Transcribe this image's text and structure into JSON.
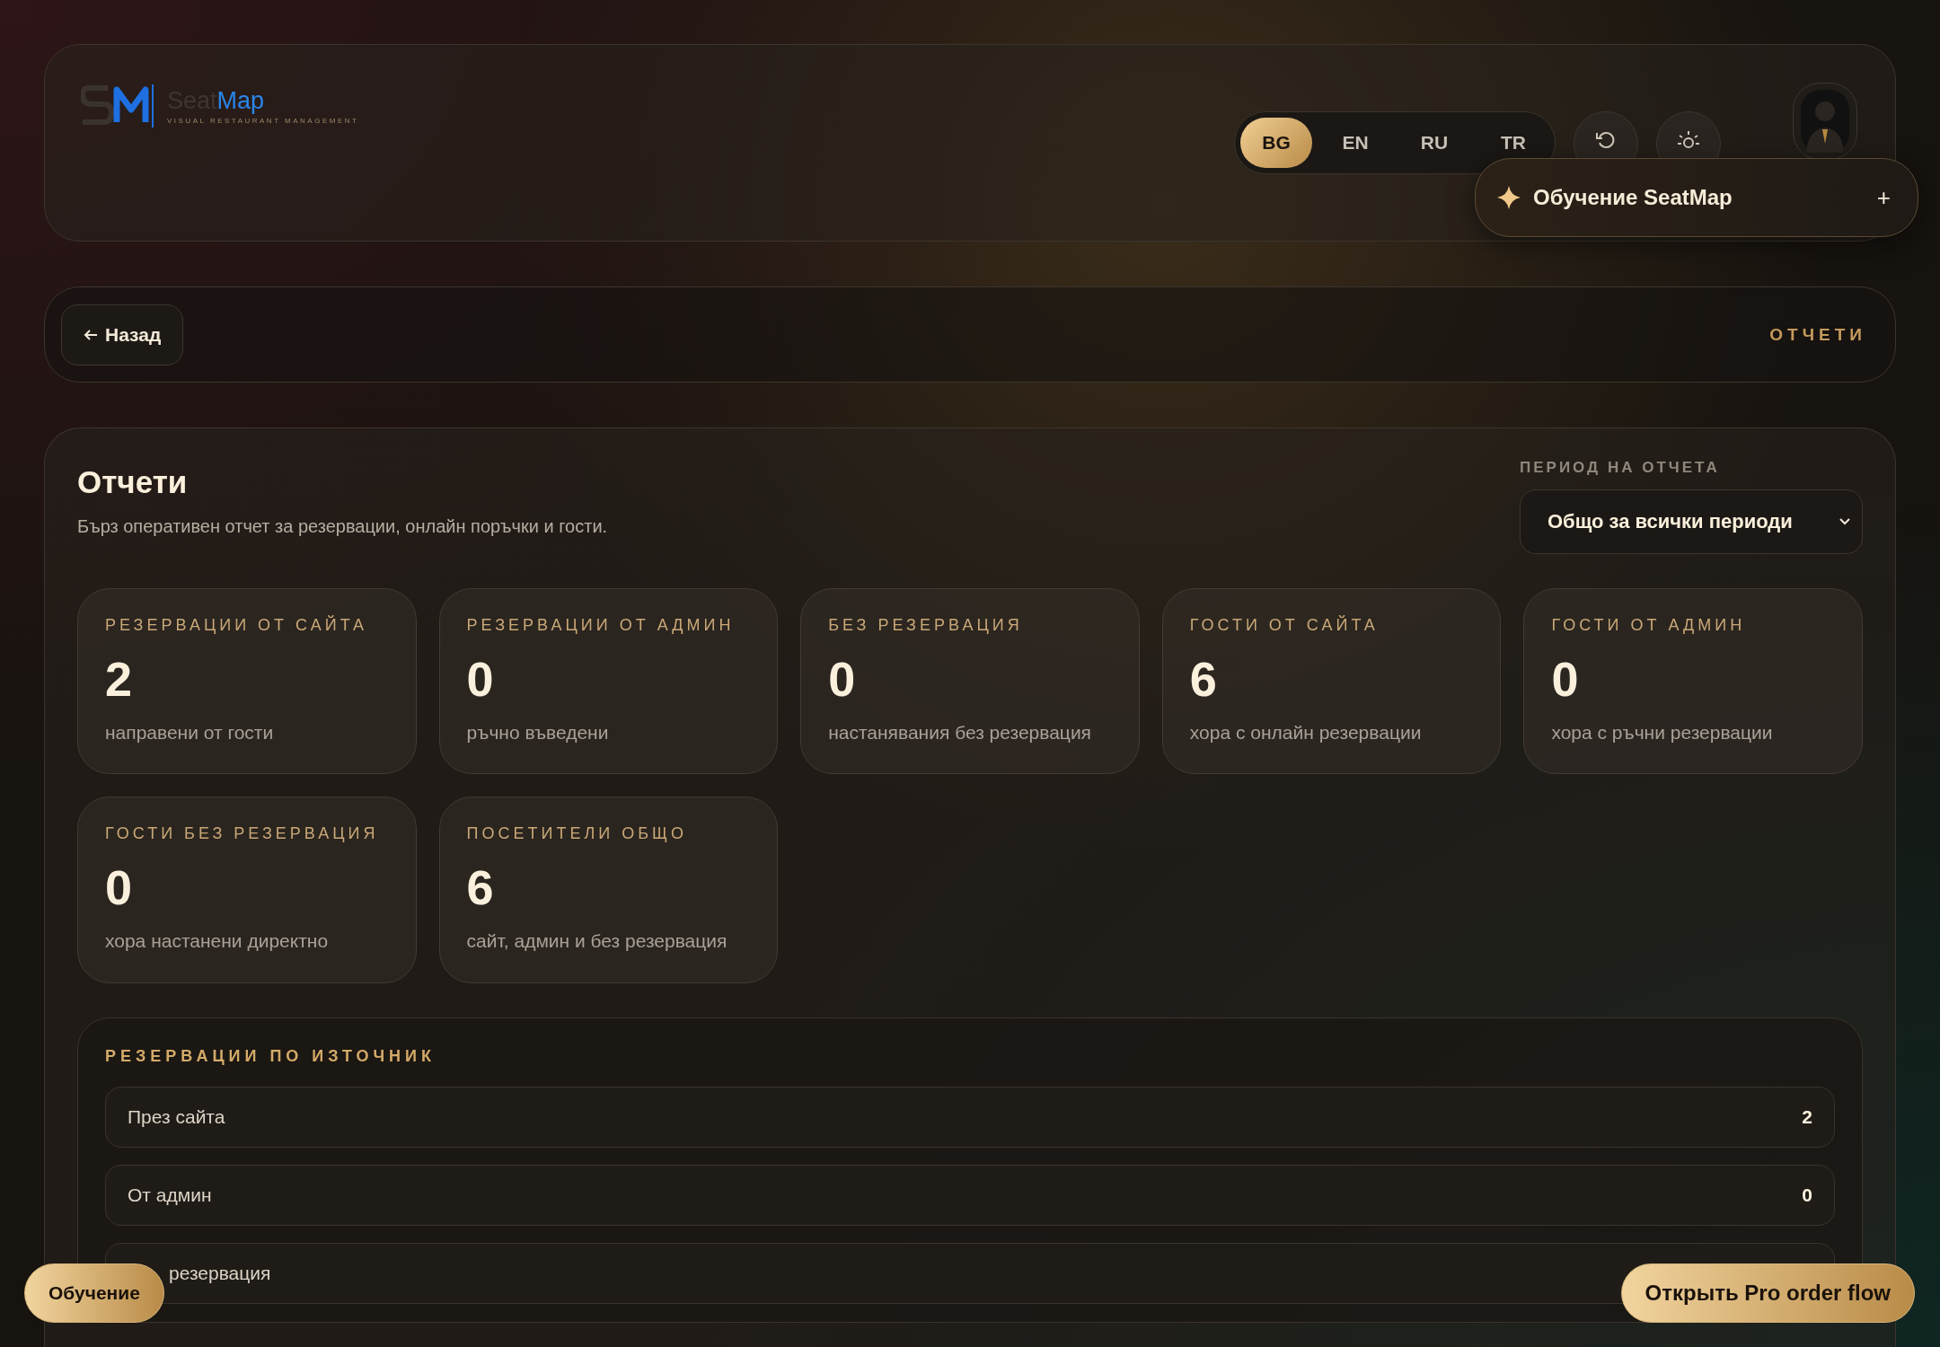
{
  "header": {
    "logo": {
      "word_1": "Seat",
      "word_2": "Map",
      "tagline": "VISUAL RESTAURANT MANAGEMENT"
    },
    "languages": [
      {
        "label": "BG",
        "selected": true
      },
      {
        "label": "EN",
        "selected": false
      },
      {
        "label": "RU",
        "selected": false
      },
      {
        "label": "TR",
        "selected": false
      }
    ],
    "tour_popup": {
      "title": "Обучение SeatMap",
      "toggle": "+"
    }
  },
  "nav": {
    "back": "Назад",
    "section": "ОТЧЕТИ"
  },
  "report": {
    "title": "Отчети",
    "subtitle": "Бърз оперативен отчет за резервации, онлайн поръчки и гости.",
    "period_label": "ПЕРИОД НА ОТЧЕТА",
    "period_value": "Общо за всички периоди",
    "stats": [
      {
        "label": "РЕЗЕРВАЦИИ ОТ САЙТА",
        "value": "2",
        "note": "направени от гости"
      },
      {
        "label": "РЕЗЕРВАЦИИ ОТ АДМИН",
        "value": "0",
        "note": "ръчно въведени"
      },
      {
        "label": "БЕЗ РЕЗЕРВАЦИЯ",
        "value": "0",
        "note": "настанявания без резервация"
      },
      {
        "label": "ГОСТИ ОТ САЙТА",
        "value": "6",
        "note": "хора с онлайн резервации"
      },
      {
        "label": "ГОСТИ ОТ АДМИН",
        "value": "0",
        "note": "хора с ръчни резервации"
      },
      {
        "label": "ГОСТИ БЕЗ РЕЗЕРВАЦИЯ",
        "value": "0",
        "note": "хора настанени директно"
      },
      {
        "label": "ПОСЕТИТЕЛИ ОБЩО",
        "value": "6",
        "note": "сайт, админ и без резервация"
      }
    ],
    "by_source": {
      "title": "РЕЗЕРВАЦИИ ПО ИЗТОЧНИК",
      "rows": [
        {
          "label": "През сайта",
          "value": "2"
        },
        {
          "label": "От админ",
          "value": "0"
        },
        {
          "label": "резервация"
        }
      ]
    }
  },
  "floating": {
    "left": "Обучение",
    "right": "Открыть Pro order flow"
  }
}
